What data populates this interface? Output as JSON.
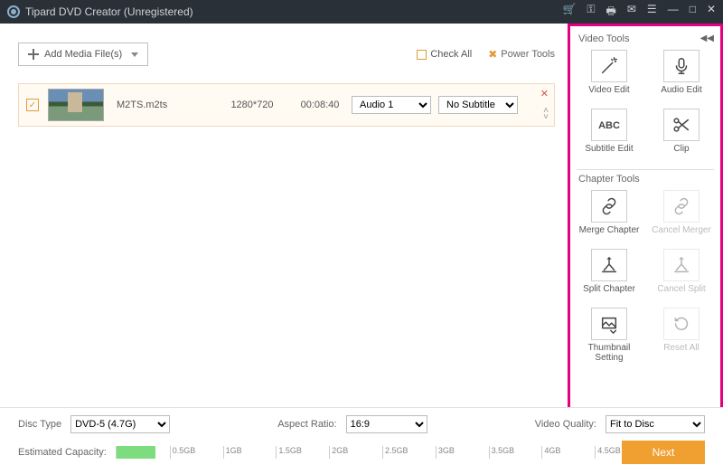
{
  "title": "Tipard DVD Creator (Unregistered)",
  "toolbar": {
    "add_label": "Add Media File(s)",
    "checkall_label": "Check All",
    "powertools_label": "Power Tools"
  },
  "file": {
    "name": "M2TS.m2ts",
    "resolution": "1280*720",
    "duration": "00:08:40",
    "audio_selected": "Audio 1",
    "subtitle_selected": "No Subtitle"
  },
  "sidebar": {
    "video_header": "Video Tools",
    "chapter_header": "Chapter Tools",
    "video_tools": [
      {
        "label": "Video Edit",
        "icon": "wand"
      },
      {
        "label": "Audio Edit",
        "icon": "mic"
      },
      {
        "label": "Subtitle Edit",
        "icon": "abc"
      },
      {
        "label": "Clip",
        "icon": "scissors"
      }
    ],
    "chapter_tools": [
      {
        "label": "Merge Chapter",
        "icon": "link",
        "disabled": false
      },
      {
        "label": "Cancel Merger",
        "icon": "link",
        "disabled": true
      },
      {
        "label": "Split Chapter",
        "icon": "split",
        "disabled": false
      },
      {
        "label": "Cancel Split",
        "icon": "split",
        "disabled": true
      },
      {
        "label": "Thumbnail Setting",
        "icon": "thumb",
        "disabled": false
      },
      {
        "label": "Reset All",
        "icon": "reset",
        "disabled": true
      }
    ]
  },
  "bottom": {
    "disc_type_label": "Disc Type",
    "disc_type_value": "DVD-5 (4.7G)",
    "aspect_label": "Aspect Ratio:",
    "aspect_value": "16:9",
    "quality_label": "Video Quality:",
    "quality_value": "Fit to Disc",
    "capacity_label": "Estimated Capacity:",
    "ticks": [
      "0.5GB",
      "1GB",
      "1.5GB",
      "2GB",
      "2.5GB",
      "3GB",
      "3.5GB",
      "4GB",
      "4.5GB"
    ],
    "fill_percent": 8,
    "next_label": "Next"
  }
}
